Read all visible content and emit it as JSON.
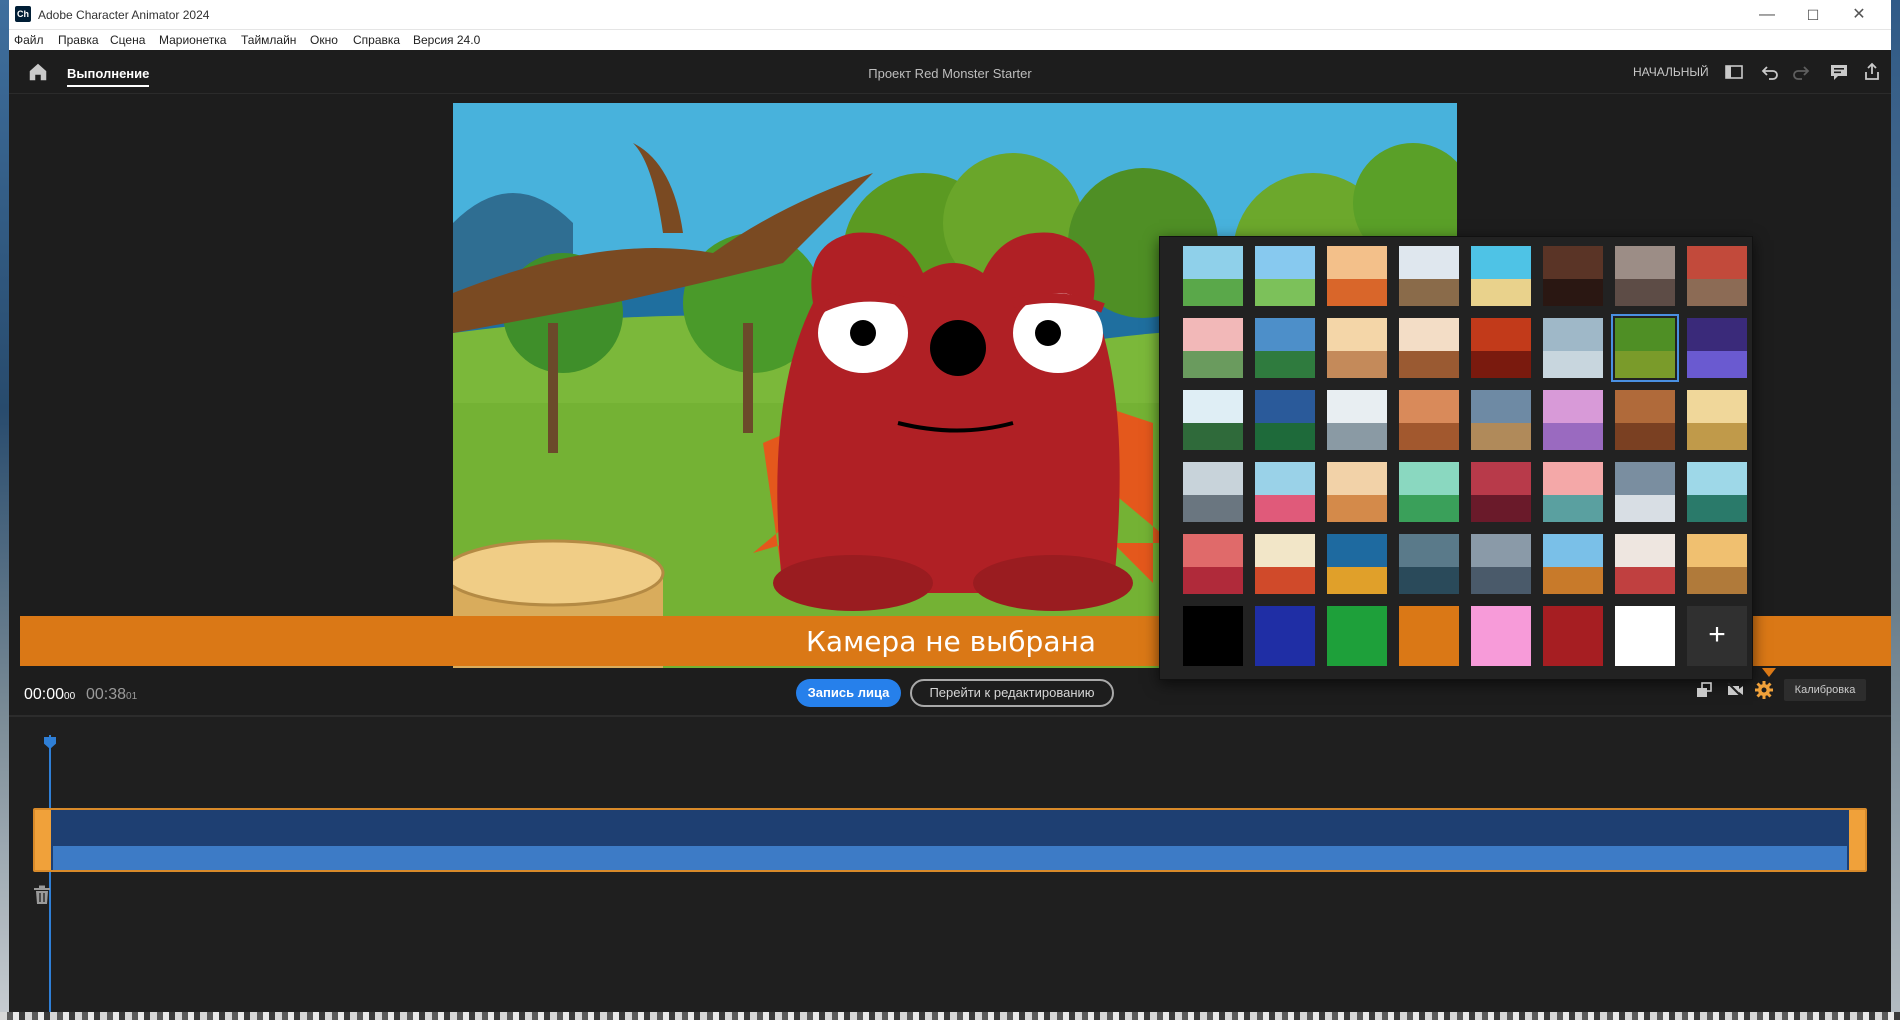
{
  "window": {
    "app_title": "Adobe Character Animator 2024",
    "logo_text": "Ch",
    "minimize_glyph": "—",
    "maximize_glyph": "☐",
    "close_glyph": "✕"
  },
  "menu": [
    "Файл",
    "Правка",
    "Сцена",
    "Марионетка",
    "Таймлайн",
    "Окно",
    "Справка",
    "Версия 24.0"
  ],
  "toolbar": {
    "mode_tab": "Выполнение",
    "project_title": "Проект Red Monster Starter",
    "workspace_label": "НАЧАЛЬНЫЙ"
  },
  "stage": {
    "camera_message": "Камера не выбрана"
  },
  "backgrounds": {
    "add_glyph": "+",
    "selected_index": 14,
    "thumbnails": [
      "forest-trees",
      "meadow-hills",
      "autumn-park",
      "winter-branches",
      "tropical-beach",
      "city-ruins",
      "house-porch",
      "kitchen-counter",
      "cherry-blossom",
      "mountain-valley",
      "cozy-room",
      "living-room-sofa",
      "red-desert",
      "office-desk",
      "forest-clearing",
      "night-city",
      "snowy-cabin",
      "stadium-lights",
      "photo-studio",
      "room-lamp",
      "misty-city",
      "pink-planet",
      "wooden-wall",
      "desert-cactus",
      "harbor-boat",
      "snowy-tree",
      "canyon-rocks",
      "green-hills",
      "red-sunset-hills",
      "pink-sky-mountains",
      "lighthouse",
      "snowy-peaks",
      "pink-cliffs",
      "playground",
      "autumn-lake",
      "town-square",
      "pirate-ship",
      "treehouse",
      "tree-swing",
      "village-house"
    ],
    "swatches": [
      "#000000",
      "#1f2ea5",
      "#1ea03a",
      "#da7816",
      "#f79bd9",
      "#a61e22",
      "#ffffff"
    ]
  },
  "controls": {
    "current_time": "00:00",
    "current_frames": "00",
    "duration_time": "00:38",
    "duration_frames": "01",
    "record_label": "Запись лица",
    "edit_label": "Перейти к редактированию",
    "calibrate_label": "Калибровка"
  },
  "colors": {
    "accent_blue": "#2680eb",
    "camera_bar": "#da7816",
    "track_fill": "#1e3f72",
    "track_handle": "#f0a13a"
  }
}
